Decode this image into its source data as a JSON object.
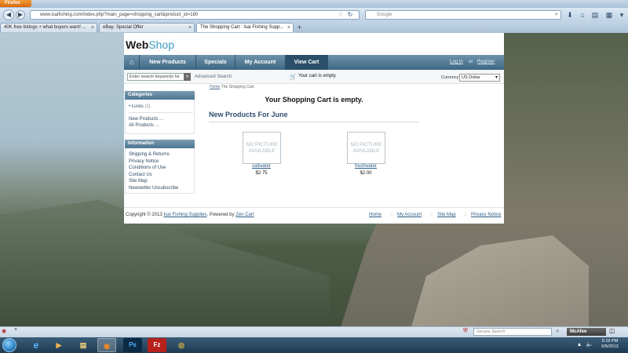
{
  "browser": {
    "app_button": "Firefox",
    "url": "www.isaifishing.com/index.php?main_page=shopping_cart&product_id=180",
    "url_domain": "isaifishing.com",
    "search_placeholder": "Google",
    "tabs": [
      {
        "label": "40K free listings + what buyers want! ..."
      },
      {
        "label": "eBay: Special Offer"
      },
      {
        "label": "The Shopping Cart : Isai Fishing Supp..."
      }
    ],
    "new_tab": "+",
    "tab_close": "×"
  },
  "site": {
    "logo_main": "Web",
    "logo_accent": "Shop",
    "menu": {
      "home_icon": "⌂",
      "items": [
        {
          "label": "New Products"
        },
        {
          "label": "Specials"
        },
        {
          "label": "My Account"
        },
        {
          "label": "View Cart"
        }
      ],
      "login": "Log In",
      "or": "or",
      "register": "Register"
    },
    "search": {
      "placeholder": "Enter search keywords he",
      "go": "»",
      "advanced": "Advanced Search"
    },
    "cart_status": "Your cart is empty",
    "currency": {
      "label": "Currency",
      "selected": "US Dollar"
    },
    "categories": {
      "title": "Categories",
      "items": [
        {
          "label": "Lures",
          "count": "(2)"
        }
      ],
      "new_products": "New Products ...",
      "all_products": "All Products ..."
    },
    "information": {
      "title": "Information",
      "links": [
        "Shipping & Returns",
        "Privacy Notice",
        "Conditions of Use",
        "Contact Us",
        "Site Map",
        "Newsletter Unsubscribe"
      ]
    },
    "breadcrumb": {
      "home": "Home",
      "current": "The Shopping Cart"
    },
    "cart_empty_message": "Your Shopping Cart is empty.",
    "new_products_title": "New Products For June",
    "products": [
      {
        "image_text": "NO PICTURE AVAILABLE",
        "name": "saltwater",
        "price": "$2.75"
      },
      {
        "image_text": "NO PICTURE AVAILABLE",
        "name": "freshwater",
        "price": "$2.00"
      }
    ],
    "footer": {
      "copyright": "Copyright © 2013",
      "shop_name": "Isai Fishing Supplies",
      "powered": ". Powered by",
      "engine": "Zen Cart",
      "links": [
        "Home",
        "My Account",
        "Site Map",
        "Privacy Notice"
      ]
    }
  },
  "addon_bar": {
    "secure_search_placeholder": "Secure Search",
    "mcafee": "McAfee"
  },
  "taskbar": {
    "time": "5:19 PM",
    "date": "6/5/2013",
    "apps": [
      {
        "name": "internet-explorer",
        "glyph": "e"
      },
      {
        "name": "media-player",
        "glyph": "▶"
      },
      {
        "name": "file-explorer",
        "glyph": "▤"
      },
      {
        "name": "firefox",
        "glyph": "◉"
      },
      {
        "name": "photoshop",
        "glyph": "Ps"
      },
      {
        "name": "filezilla",
        "glyph": "Fz"
      },
      {
        "name": "chrome",
        "glyph": "◎"
      }
    ]
  },
  "colors": {
    "accent": "#3a9ac2",
    "menu_bar": "#3c6784",
    "firefox_orange": "#e67a1b"
  }
}
